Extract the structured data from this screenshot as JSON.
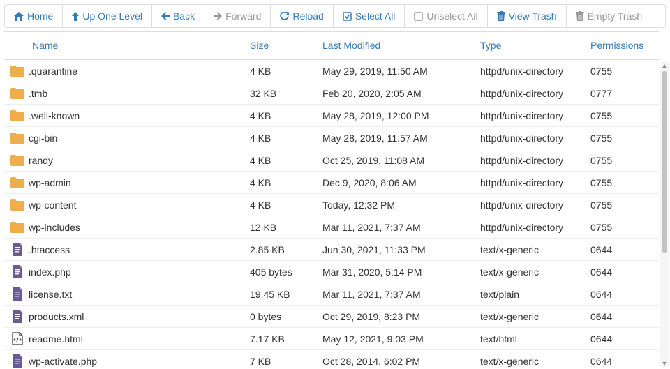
{
  "toolbar": {
    "home": "Home",
    "up": "Up One Level",
    "back": "Back",
    "forward": "Forward",
    "reload": "Reload",
    "select_all": "Select All",
    "unselect_all": "Unselect All",
    "view_trash": "View Trash",
    "empty_trash": "Empty Trash"
  },
  "columns": {
    "name": "Name",
    "size": "Size",
    "modified": "Last Modified",
    "type": "Type",
    "perm": "Permissions"
  },
  "rows": [
    {
      "icon": "folder",
      "name": ".quarantine",
      "size": "4 KB",
      "modified": "May 29, 2019, 11:50 AM",
      "type": "httpd/unix-directory",
      "perm": "0755"
    },
    {
      "icon": "folder",
      "name": ".tmb",
      "size": "32 KB",
      "modified": "Feb 20, 2020, 2:05 AM",
      "type": "httpd/unix-directory",
      "perm": "0777"
    },
    {
      "icon": "folder",
      "name": ".well-known",
      "size": "4 KB",
      "modified": "May 28, 2019, 12:00 PM",
      "type": "httpd/unix-directory",
      "perm": "0755"
    },
    {
      "icon": "folder",
      "name": "cgi-bin",
      "size": "4 KB",
      "modified": "May 28, 2019, 11:57 AM",
      "type": "httpd/unix-directory",
      "perm": "0755"
    },
    {
      "icon": "folder",
      "name": "randy",
      "size": "4 KB",
      "modified": "Oct 25, 2019, 11:08 AM",
      "type": "httpd/unix-directory",
      "perm": "0755"
    },
    {
      "icon": "folder",
      "name": "wp-admin",
      "size": "4 KB",
      "modified": "Dec 9, 2020, 8:06 AM",
      "type": "httpd/unix-directory",
      "perm": "0755"
    },
    {
      "icon": "folder",
      "name": "wp-content",
      "size": "4 KB",
      "modified": "Today, 12:32 PM",
      "type": "httpd/unix-directory",
      "perm": "0755"
    },
    {
      "icon": "folder",
      "name": "wp-includes",
      "size": "12 KB",
      "modified": "Mar 11, 2021, 7:37 AM",
      "type": "httpd/unix-directory",
      "perm": "0755"
    },
    {
      "icon": "file-text",
      "name": ".htaccess",
      "size": "2.85 KB",
      "modified": "Jun 30, 2021, 11:33 PM",
      "type": "text/x-generic",
      "perm": "0644"
    },
    {
      "icon": "file-text",
      "name": "index.php",
      "size": "405 bytes",
      "modified": "Mar 31, 2020, 5:14 PM",
      "type": "text/x-generic",
      "perm": "0644"
    },
    {
      "icon": "file-text",
      "name": "license.txt",
      "size": "19.45 KB",
      "modified": "Mar 11, 2021, 7:37 AM",
      "type": "text/plain",
      "perm": "0644"
    },
    {
      "icon": "file-text",
      "name": "products.xml",
      "size": "0 bytes",
      "modified": "Oct 29, 2019, 8:23 PM",
      "type": "text/x-generic",
      "perm": "0644"
    },
    {
      "icon": "file-code",
      "name": "readme.html",
      "size": "7.17 KB",
      "modified": "May 12, 2021, 9:03 PM",
      "type": "text/html",
      "perm": "0644"
    },
    {
      "icon": "file-text",
      "name": "wp-activate.php",
      "size": "7 KB",
      "modified": "Oct 28, 2014, 6:02 PM",
      "type": "text/x-generic",
      "perm": "0644"
    }
  ]
}
